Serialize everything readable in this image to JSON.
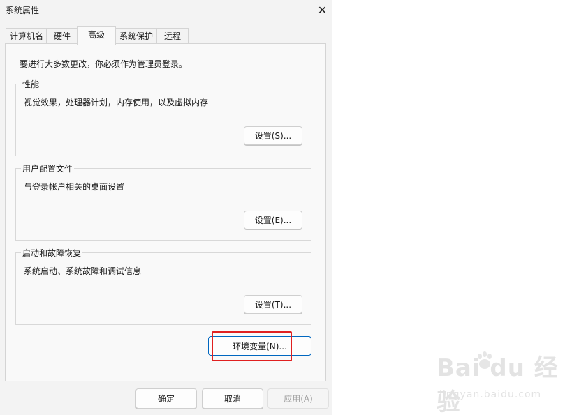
{
  "window": {
    "title": "系统属性"
  },
  "tabs": [
    {
      "label": "计算机名"
    },
    {
      "label": "硬件"
    },
    {
      "label": "高级",
      "active": true
    },
    {
      "label": "系统保护"
    },
    {
      "label": "远程"
    }
  ],
  "advanced": {
    "intro": "要进行大多数更改，你必须作为管理员登录。",
    "performance": {
      "label": "性能",
      "desc": "视觉效果，处理器计划，内存使用，以及虚拟内存",
      "button": "设置(S)..."
    },
    "user_profiles": {
      "label": "用户配置文件",
      "desc": "与登录帐户相关的桌面设置",
      "button": "设置(E)..."
    },
    "startup_recovery": {
      "label": "启动和故障恢复",
      "desc": "系统启动、系统故障和调试信息",
      "button": "设置(T)..."
    },
    "env_button": "环境变量(N)..."
  },
  "footer": {
    "ok": "确定",
    "cancel": "取消",
    "apply": "应用(A)"
  },
  "watermark": {
    "logo": "Bai du 经验",
    "url": "jingyan.baidu.com"
  },
  "colors": {
    "accent": "#0067c0",
    "highlight": "#e02020"
  }
}
